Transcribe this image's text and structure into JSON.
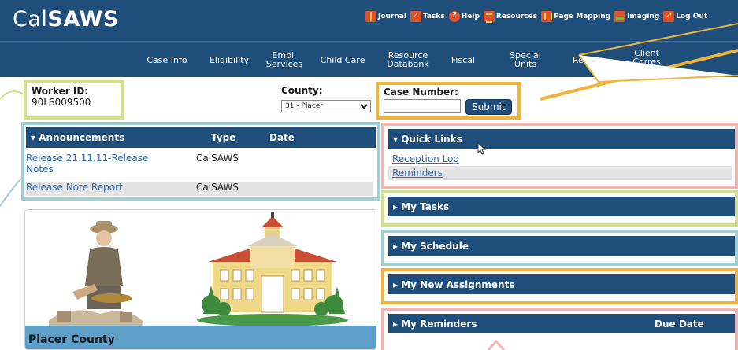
{
  "app": {
    "logo_prefix": "Cal",
    "logo_bold": "SAWS"
  },
  "header_links": [
    {
      "label": "Journal",
      "icon": "journal-icon"
    },
    {
      "label": "Tasks",
      "icon": "tasks-icon"
    },
    {
      "label": "Help",
      "icon": "help-icon"
    },
    {
      "label": "Resources",
      "icon": "resources-icon"
    },
    {
      "label": "Page Mapping",
      "icon": "page-mapping-icon"
    },
    {
      "label": "Imaging",
      "icon": "imaging-icon"
    },
    {
      "label": "Log Out",
      "icon": "log-out-icon"
    }
  ],
  "nav": [
    "Case Info",
    "Eligibility",
    "Empl.\nServices",
    "Child Care",
    "Resource\nDatabank",
    "Fiscal",
    "Special\nUnits",
    "Reports",
    "Client\nCorres"
  ],
  "worker": {
    "label": "Worker ID:",
    "id": "90LS009500"
  },
  "county": {
    "label": "County:",
    "selected": "31 - Placer"
  },
  "case": {
    "label": "Case Number:",
    "value": "",
    "submit_label": "Submit"
  },
  "announcements": {
    "title": "Announcements",
    "col_type": "Type",
    "col_date": "Date",
    "rows": [
      {
        "title_line1": "Release 21.11.11-Release",
        "title_line2": "Notes",
        "type": "CalSAWS"
      },
      {
        "title_line1": "Release Note Report",
        "type": "CalSAWS"
      }
    ]
  },
  "county_image": {
    "caption": "Placer County"
  },
  "quick_links": {
    "title": "Quick Links",
    "links": [
      "Reception Log",
      "Reminders"
    ]
  },
  "panels": {
    "my_tasks": "My Tasks",
    "my_schedule": "My Schedule",
    "my_new_assignments": "My New Assignments",
    "my_reminders": "My Reminders",
    "due_date": "Due Date"
  },
  "colors": {
    "brand_blue": "#1e4e79",
    "link_blue": "#2b6bb0",
    "highlight_green": "#d4df8a",
    "highlight_orange": "#f0b43c",
    "highlight_teal": "#9fcfd3",
    "highlight_pink": "#f2b6b0"
  }
}
